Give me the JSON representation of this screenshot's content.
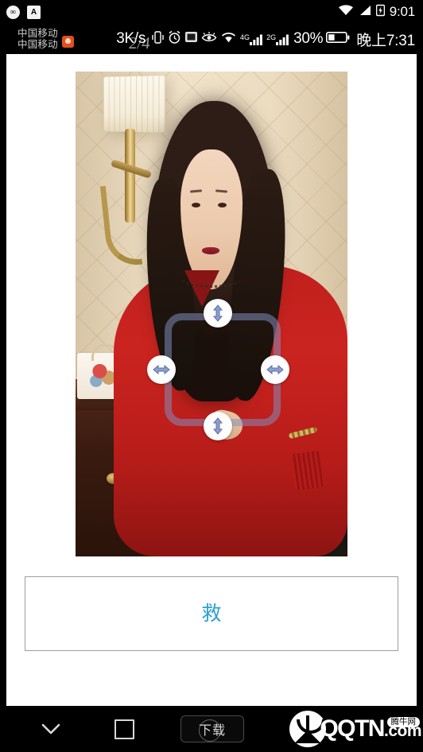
{
  "status_bar": {
    "notification_icons": [
      "cellular-data-icon",
      "app-badge-icon"
    ],
    "wifi_icon": "wifi-icon",
    "signal_icon": "signal-icon",
    "battery_icon": "battery-icon",
    "clock": "9:01"
  },
  "status_row": {
    "carrier_primary": "中国移动",
    "carrier_secondary": "中国移动",
    "carrier_badge": "message-badge-icon",
    "network_speed": "3K/s",
    "vibrate_icon": "vibrate-icon",
    "alarm_icon": "alarm-clock-icon",
    "screenshot_icon": "screenshot-icon",
    "eye_icon": "eye-protect-icon",
    "wifi_icon": "wifi-icon",
    "sim1_label": "4G",
    "sim1_icon": "signal-bars-icon",
    "sim2_label": "2G",
    "sim2_icon": "signal-bars-icon",
    "battery_percent": "30%",
    "battery_icon": "battery-icon",
    "clock": "晚上7:31",
    "overlay_text": "2/4"
  },
  "photo": {
    "alt_name": "portrait-photo",
    "description": "红色毛衣女子肖像"
  },
  "crop_tool": {
    "handle_top": "resize-vertical-handle",
    "handle_bottom": "resize-vertical-handle",
    "handle_left": "resize-horizontal-handle",
    "handle_right": "resize-horizontal-handle",
    "frame_color": "#8292c4"
  },
  "text_box": {
    "value": "救",
    "placeholder": "",
    "text_color": "#2e9fd4"
  },
  "nav_bar": {
    "back_icon": "chevron-down-icon",
    "recents_icon": "square-icon",
    "download_label": "下载"
  },
  "watermark": {
    "emblem": "bull-head-logo-icon",
    "site_name": "QQTN",
    "domain": ".com",
    "badge": "腾牛网"
  }
}
